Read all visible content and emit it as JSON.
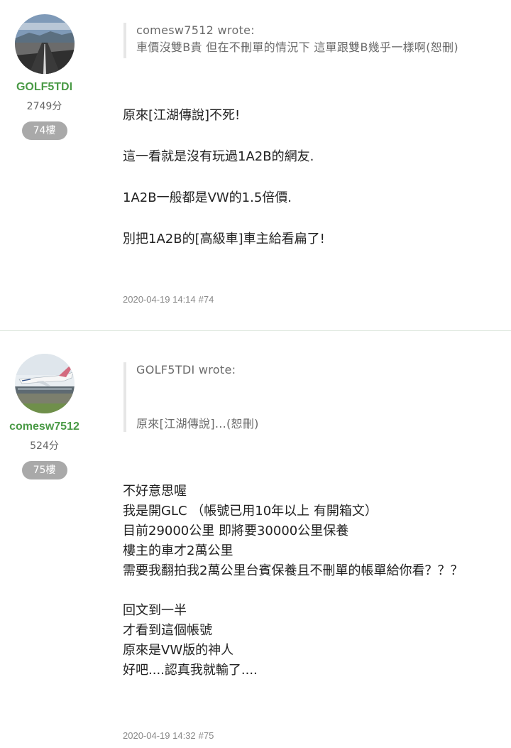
{
  "posts": [
    {
      "author": "GOLF5TDI",
      "score": "2749分",
      "floor": "74樓",
      "quote_author": "comesw7512 wrote:",
      "quote_text": "車價沒雙B貴 但在不刪單的情況下 這單跟雙B幾乎一樣啊(恕刪)",
      "body": [
        "原來[江湖傳說]不死!",
        "這一看就是沒有玩過1A2B的網友.",
        "1A2B一般都是VW的1.5倍價.",
        "別把1A2B的[高級車]車主給看扁了!"
      ],
      "date": "2020-04-19 14:14",
      "num": "#74"
    },
    {
      "author": "comesw7512",
      "score": "524分",
      "floor": "75樓",
      "quote_author": "GOLF5TDI wrote:",
      "quote_text": "原來[江湖傳說]...(恕刪)",
      "body": [
        "不好意思喔",
        "我是開GLC （帳號已用10年以上 有開箱文）",
        "目前29000公里 即將要30000公里保養",
        "樓主的車才2萬公里",
        "需要我翻拍我2萬公里台賓保養且不刪單的帳單給你看？？？",
        "回文到一半",
        "才看到這個帳號",
        "原來是VW版的神人",
        "好吧....認真我就輸了...."
      ],
      "date": "2020-04-19 14:32",
      "num": "#75"
    }
  ],
  "colors": {
    "username": "#4a9a46",
    "floor_badge": "#a9a9a9",
    "quote_bar": "#e6e6e6"
  },
  "icons": [
    "road-avatar",
    "airplane-avatar"
  ]
}
